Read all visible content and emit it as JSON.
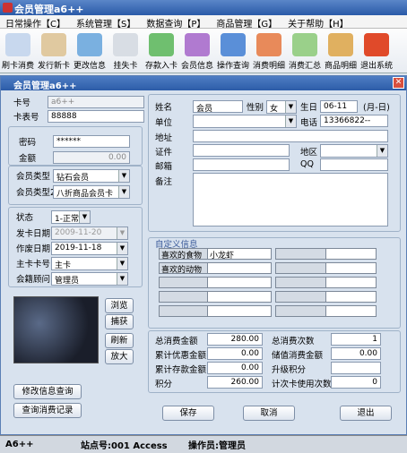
{
  "app": {
    "title": "会员管理a6++"
  },
  "menu": [
    "日常操作【C】",
    "系统管理【S】",
    "数据查询【P】",
    "商品管理【G】",
    "关于帮助【H】"
  ],
  "toolbar": [
    {
      "label": "刷卡消费",
      "icon": "pos-icon",
      "color": "#c8d8ee"
    },
    {
      "label": "发行新卡",
      "icon": "new-card-icon",
      "color": "#e0c9a0"
    },
    {
      "label": "更改信息",
      "icon": "edit-info-icon",
      "color": "#7ab0e0"
    },
    {
      "label": "挂失卡",
      "icon": "lost-card-icon",
      "color": "#d8dde4"
    },
    {
      "label": "存款入卡",
      "icon": "deposit-icon",
      "color": "#6fbf6f"
    },
    {
      "label": "会员信息",
      "icon": "members-icon",
      "color": "#b07ad0"
    },
    {
      "label": "操作查询",
      "icon": "query-icon",
      "color": "#5a8fd8"
    },
    {
      "label": "消费明细",
      "icon": "pie-chart-icon",
      "color": "#e88a5a"
    },
    {
      "label": "消费汇总",
      "icon": "spreadsheet-icon",
      "color": "#9ad08a"
    },
    {
      "label": "商品明细",
      "icon": "goods-icon",
      "color": "#e0b060"
    },
    {
      "label": "退出系统",
      "icon": "exit-icon",
      "color": "#e04a2a"
    }
  ],
  "form": {
    "window_title": "会员管理a6++",
    "card_no": {
      "label": "卡号",
      "value": "a6++"
    },
    "card_face": {
      "label": "卡表号",
      "value": "88888"
    },
    "password": {
      "label": "密码",
      "value": "******"
    },
    "amount": {
      "label": "金额",
      "value": "0.00"
    },
    "member_type": {
      "label": "会员类型",
      "value": "钻石会员"
    },
    "member_type2": {
      "label": "会员类型2",
      "value": "八折商品会员卡"
    },
    "status": {
      "label": "状态",
      "value": "1-正常"
    },
    "issue_date": {
      "label": "发卡日期",
      "value": "2009-11-20"
    },
    "void_date": {
      "label": "作废日期",
      "value": "2019-11-18"
    },
    "main_card": {
      "label": "主卡卡号",
      "value": "主卡"
    },
    "consultant": {
      "label": "会籍顾问",
      "value": "管理员"
    },
    "name": {
      "label": "姓名",
      "value": "会员"
    },
    "gender": {
      "label": "性别",
      "value": "女"
    },
    "birthday": {
      "label": "生日",
      "value": "06-11",
      "hint": "(月-日)"
    },
    "unit": {
      "label": "单位",
      "value": ""
    },
    "phone": {
      "label": "电话",
      "value": "13366822--"
    },
    "address": {
      "label": "地址",
      "value": ""
    },
    "id_no": {
      "label": "证件",
      "value": ""
    },
    "region": {
      "label": "地区",
      "value": ""
    },
    "email": {
      "label": "邮箱",
      "value": ""
    },
    "qq": {
      "label": "QQ",
      "value": ""
    },
    "remark": {
      "label": "备注",
      "value": ""
    }
  },
  "custom": {
    "title": "自定义信息",
    "rows": [
      [
        "喜欢的食物",
        "小龙虾",
        "",
        ""
      ],
      [
        "喜欢的动物",
        "",
        "",
        ""
      ],
      [
        "",
        "",
        "",
        ""
      ],
      [
        "",
        "",
        "",
        ""
      ],
      [
        "",
        "",
        "",
        ""
      ]
    ]
  },
  "photo_buttons": [
    "浏览",
    "捕获",
    "刷新",
    "放大"
  ],
  "bottom_left_buttons": [
    "修改信息查询",
    "查询消费记录"
  ],
  "summary": [
    {
      "label": "总消费金额",
      "value": "280.00"
    },
    {
      "label": "总消费次数",
      "value": "1"
    },
    {
      "label": "累计优惠金额",
      "value": "0.00"
    },
    {
      "label": "储值消费金额",
      "value": "0.00"
    },
    {
      "label": "累计存款金额",
      "value": "0.00"
    },
    {
      "label": "升级积分",
      "value": ""
    },
    {
      "label": "积分",
      "value": "260.00"
    },
    {
      "label": "计次卡使用次数",
      "value": "0"
    }
  ],
  "actions": {
    "save": "保存",
    "cancel": "取消",
    "exit": "退出"
  },
  "status": {
    "app": "A6++",
    "station": "站点号:001 Access",
    "operator": "操作员:管理员"
  }
}
